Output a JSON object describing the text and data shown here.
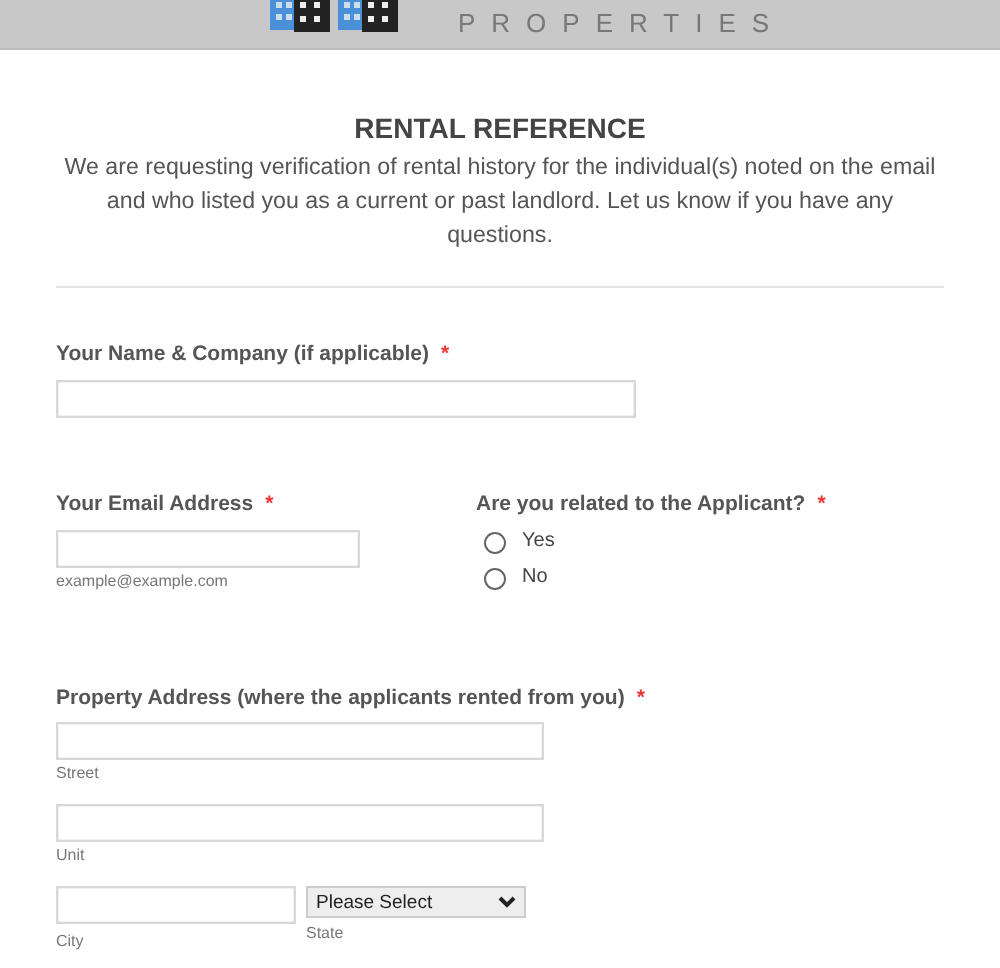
{
  "header": {
    "brand": "PROPERTIES"
  },
  "title": "RENTAL REFERENCE",
  "description": "We are requesting verification of rental history for the individual(s) noted on the email and who listed you as a current or past landlord. Let us know if you have any questions.",
  "name_field": {
    "label": "Your Name & Company (if applicable)",
    "required": true
  },
  "email_field": {
    "label": "Your Email Address",
    "required": true,
    "hint": "example@example.com"
  },
  "related_question": {
    "label": "Are you related to the Applicant?",
    "required": true,
    "options": [
      {
        "label": "Yes",
        "selected": false
      },
      {
        "label": "No",
        "selected": false
      }
    ]
  },
  "address": {
    "label": "Property Address (where the applicants rented from you)",
    "required": true,
    "street": {
      "sublabel": "Street"
    },
    "unit": {
      "sublabel": "Unit"
    },
    "city": {
      "sublabel": "City"
    },
    "state": {
      "value": "Please Select",
      "sublabel": "State"
    }
  },
  "required_mark": "*"
}
